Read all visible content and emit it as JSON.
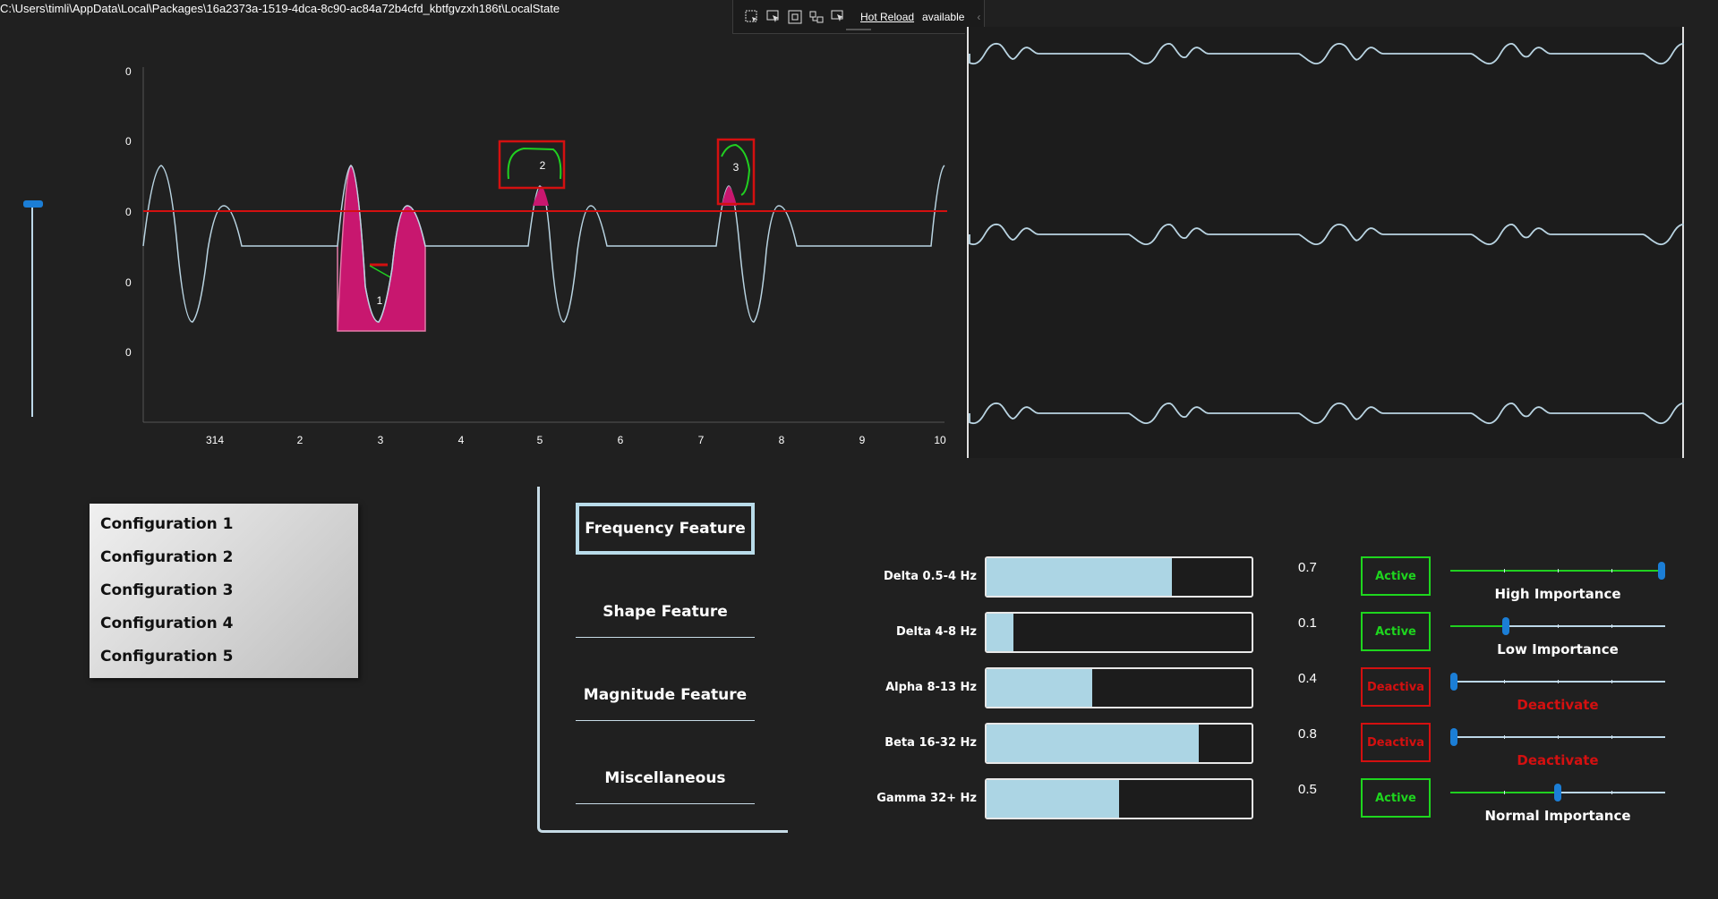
{
  "window": {
    "path": "C:\\Users\\timli\\AppData\\Local\\Packages\\16a2373a-1519-4dca-8c90-ac84a72b4cfd_kbtfgvzxh186t\\LocalState"
  },
  "debug_toolbar": {
    "icons": [
      "select-element-icon",
      "pointer-icon",
      "display-layout-adorners-icon",
      "track-focus-icon",
      "live-visual-tree-icon"
    ],
    "hot_reload_link": "Hot Reload",
    "hot_reload_status": "available"
  },
  "threshold_slider": {
    "value_fraction": 0.02
  },
  "chart_data": {
    "type": "line",
    "y_tick_labels": [
      "0",
      "0",
      "0",
      "0",
      "0"
    ],
    "x_tick_labels": [
      "314",
      "2",
      "3",
      "4",
      "5",
      "6",
      "7",
      "8",
      "9",
      "10"
    ],
    "threshold_color": "#d41010",
    "line_color": "#b9d4e2",
    "highlight_color": "#c8176f",
    "annotation_labels": [
      "1",
      "2",
      "3"
    ]
  },
  "configurations": [
    "Configuration 1",
    "Configuration 2",
    "Configuration 3",
    "Configuration 4",
    "Configuration 5"
  ],
  "feature_tabs": [
    "Frequency Feature",
    "Shape Feature",
    "Magnitude Feature",
    "Miscellaneous"
  ],
  "bands": [
    {
      "label": "Delta 0.5-4 Hz",
      "fill": 0.7,
      "value": "0.7",
      "status": "Active",
      "importance": "High Importance",
      "slider": 1.0
    },
    {
      "label": "Delta 4-8 Hz",
      "fill": 0.1,
      "value": "0.1",
      "status": "Active",
      "importance": "Low Importance",
      "slider": 0.25
    },
    {
      "label": "Alpha 8-13 Hz",
      "fill": 0.4,
      "value": "0.4",
      "status": "Deactiva",
      "importance": "Deactivate",
      "slider": 0.0
    },
    {
      "label": "Beta 16-32 Hz",
      "fill": 0.8,
      "value": "0.8",
      "status": "Deactiva",
      "importance": "Deactivate",
      "slider": 0.0
    },
    {
      "label": "Gamma 32+ Hz",
      "fill": 0.5,
      "value": "0.5",
      "status": "Active",
      "importance": "Normal Importance",
      "slider": 0.5
    }
  ],
  "colors": {
    "active": "#1ed61e",
    "deactivate": "#d41010",
    "accent": "#1b7ed6",
    "bar_fill": "#acd5e4"
  }
}
